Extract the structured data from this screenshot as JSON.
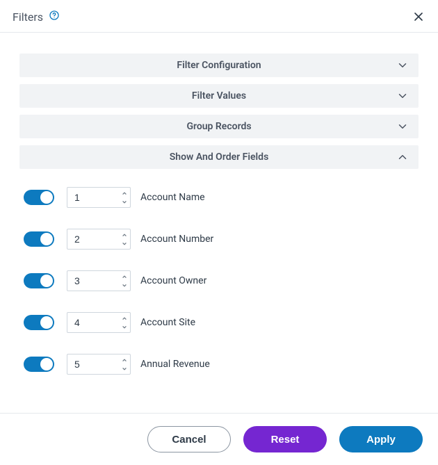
{
  "header": {
    "title": "Filters"
  },
  "accordions": {
    "filter_configuration": "Filter Configuration",
    "filter_values": "Filter Values",
    "group_records": "Group Records",
    "show_order_fields": "Show And Order Fields"
  },
  "fields": [
    {
      "order": "1",
      "label": "Account Name",
      "enabled": true
    },
    {
      "order": "2",
      "label": "Account Number",
      "enabled": true
    },
    {
      "order": "3",
      "label": "Account Owner",
      "enabled": true
    },
    {
      "order": "4",
      "label": "Account Site",
      "enabled": true
    },
    {
      "order": "5",
      "label": "Annual Revenue",
      "enabled": true
    }
  ],
  "footer": {
    "cancel": "Cancel",
    "reset": "Reset",
    "apply": "Apply"
  }
}
